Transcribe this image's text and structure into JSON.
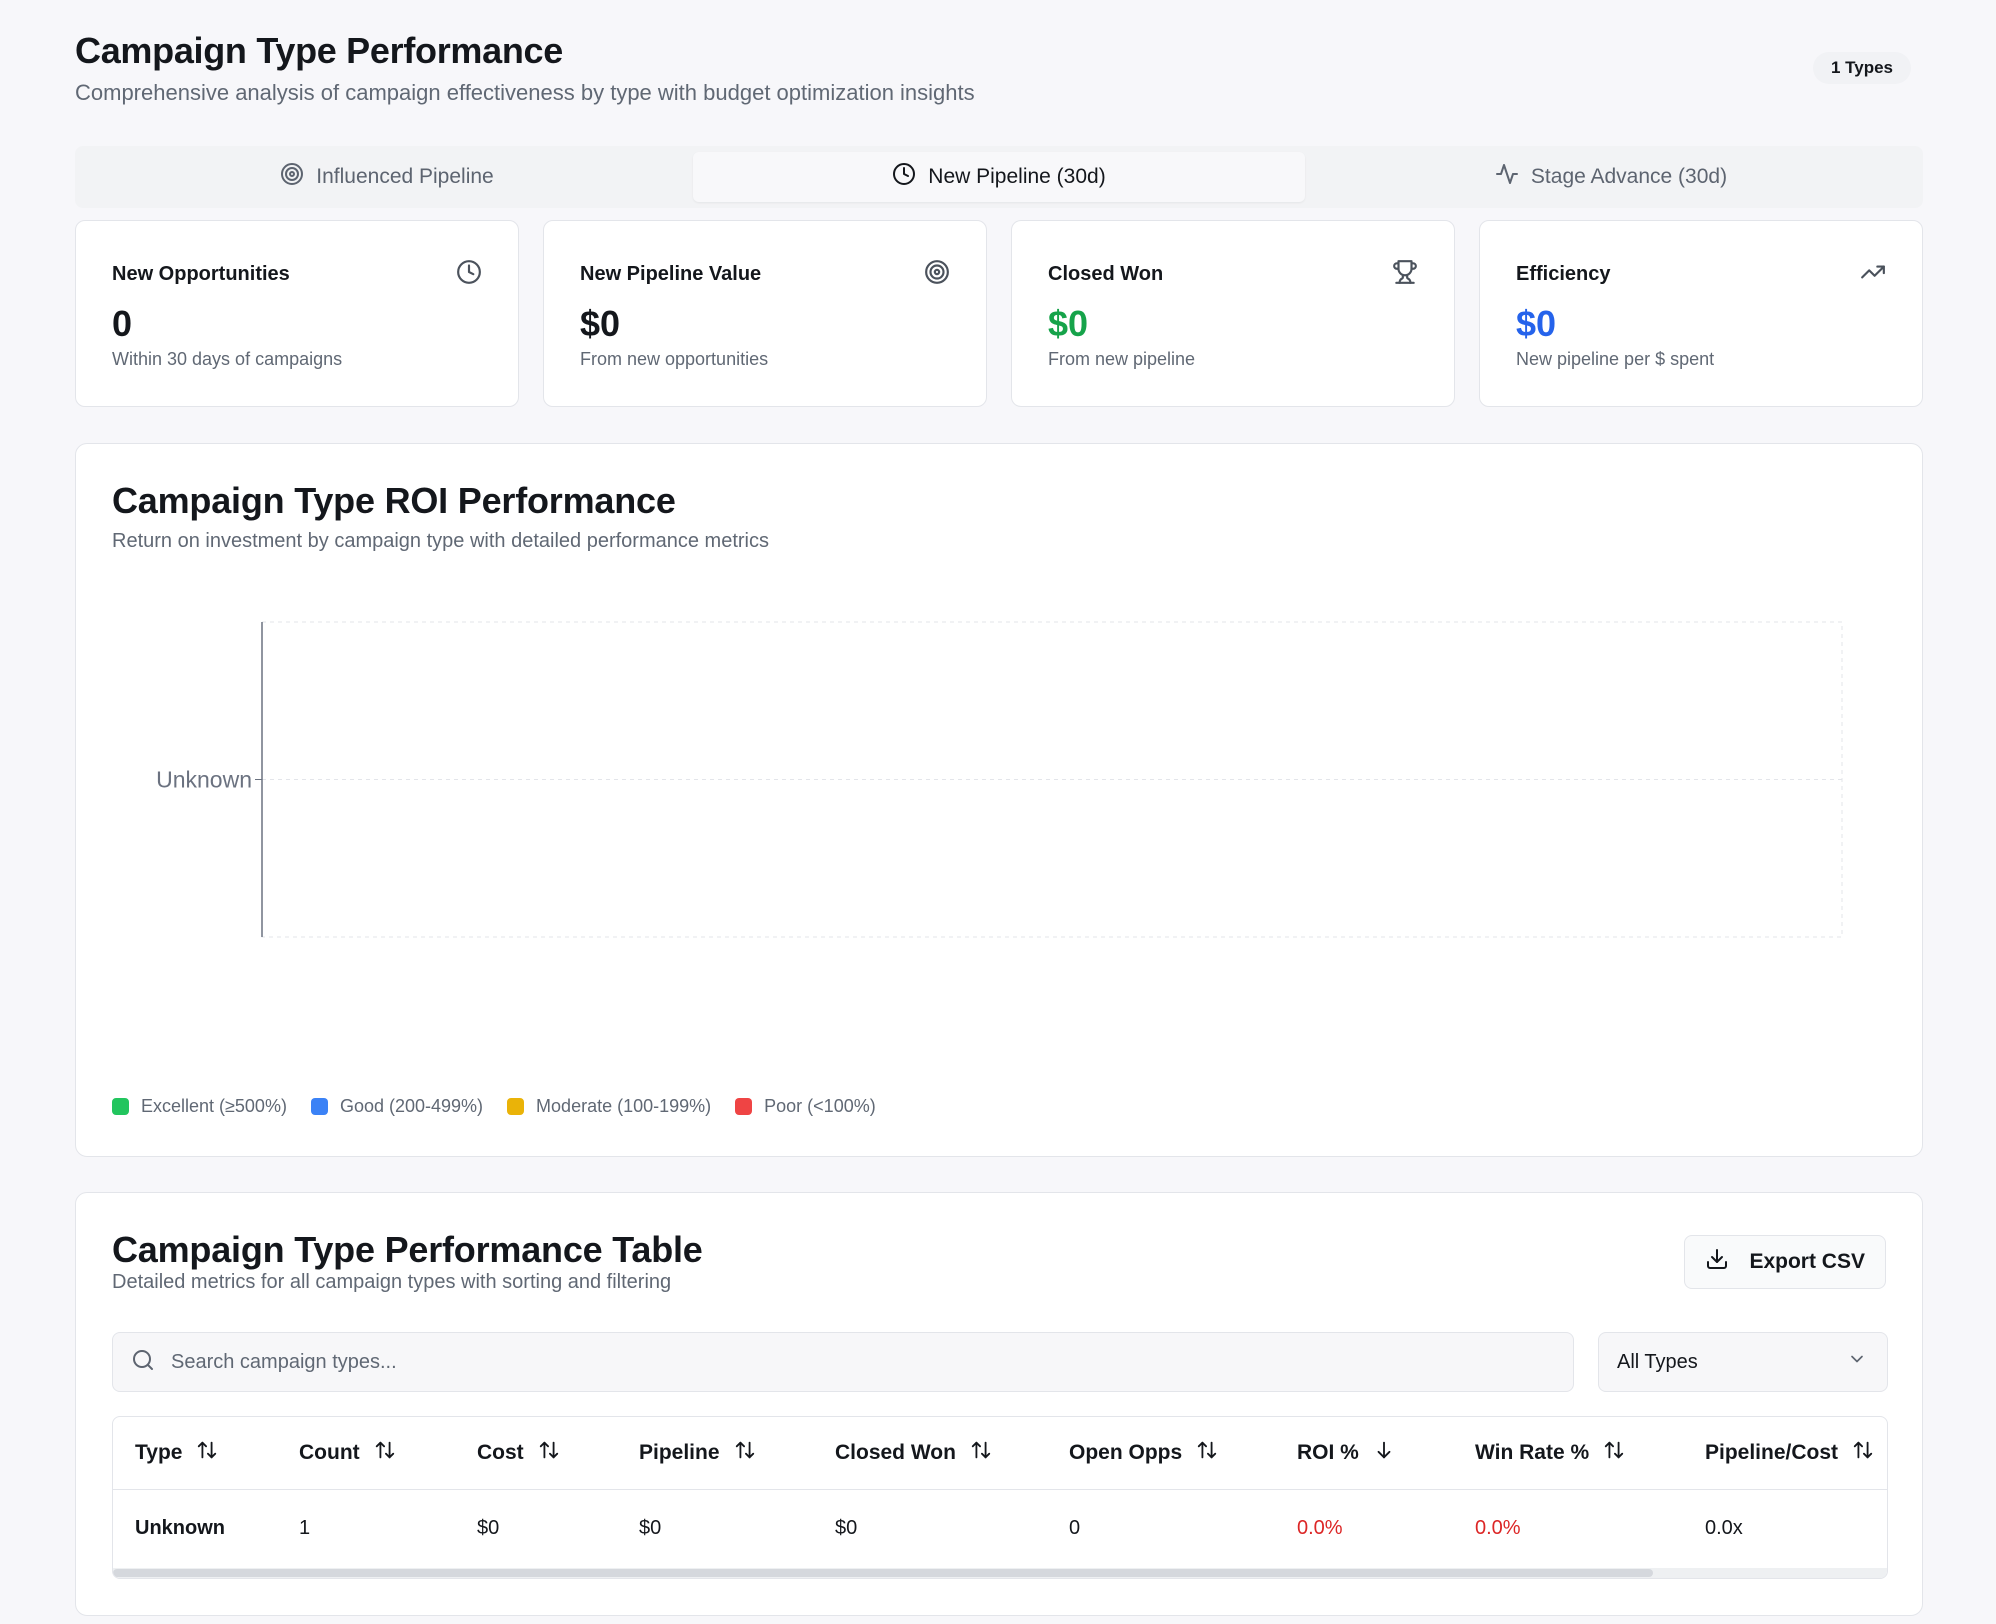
{
  "header": {
    "title": "Campaign Type Performance",
    "subtitle": "Comprehensive analysis of campaign effectiveness by type with budget optimization insights",
    "types_badge": "1 Types"
  },
  "tabs": [
    {
      "label": "Influenced Pipeline",
      "icon": "target-icon",
      "active": false
    },
    {
      "label": "New Pipeline (30d)",
      "icon": "clock-icon",
      "active": true
    },
    {
      "label": "Stage Advance (30d)",
      "icon": "activity-icon",
      "active": false
    }
  ],
  "kpis": [
    {
      "title": "New Opportunities",
      "value": "0",
      "desc": "Within 30 days of campaigns",
      "icon": "clock-icon"
    },
    {
      "title": "New Pipeline Value",
      "value": "$0",
      "desc": "From new opportunities",
      "icon": "target-icon"
    },
    {
      "title": "Closed Won",
      "value": "$0",
      "desc": "From new pipeline",
      "icon": "trophy-icon",
      "color": "#16a34a"
    },
    {
      "title": "Efficiency",
      "value": "$0",
      "desc": "New pipeline per $ spent",
      "icon": "trending-up-icon",
      "color": "#2563eb"
    }
  ],
  "roi_chart": {
    "title": "Campaign Type ROI Performance",
    "subtitle": "Return on investment by campaign type with detailed performance metrics",
    "legend": [
      {
        "label": "Excellent (≥500%)",
        "color": "#22c55e"
      },
      {
        "label": "Good (200-499%)",
        "color": "#3b82f6"
      },
      {
        "label": "Moderate (100-199%)",
        "color": "#eab308"
      },
      {
        "label": "Poor (<100%)",
        "color": "#ef4444"
      }
    ]
  },
  "chart_data": {
    "type": "bar",
    "orientation": "horizontal",
    "categories": [
      "Unknown"
    ],
    "values": [
      0
    ],
    "title": "Campaign Type ROI Performance",
    "grid": true
  },
  "table_section": {
    "title": "Campaign Type Performance Table",
    "subtitle": "Detailed metrics for all campaign types with sorting and filtering",
    "export_label": "Export CSV",
    "search_placeholder": "Search campaign types...",
    "filter_value": "All Types",
    "columns": [
      "Type",
      "Count",
      "Cost",
      "Pipeline",
      "Closed Won",
      "Open Opps",
      "ROI %",
      "Win Rate %",
      "Pipeline/Cost"
    ],
    "sorted_column": "ROI %",
    "rows": [
      [
        "Unknown",
        "1",
        "$0",
        "$0",
        "$0",
        "0",
        "0.0%",
        "0.0%",
        "0.0x"
      ]
    ]
  }
}
